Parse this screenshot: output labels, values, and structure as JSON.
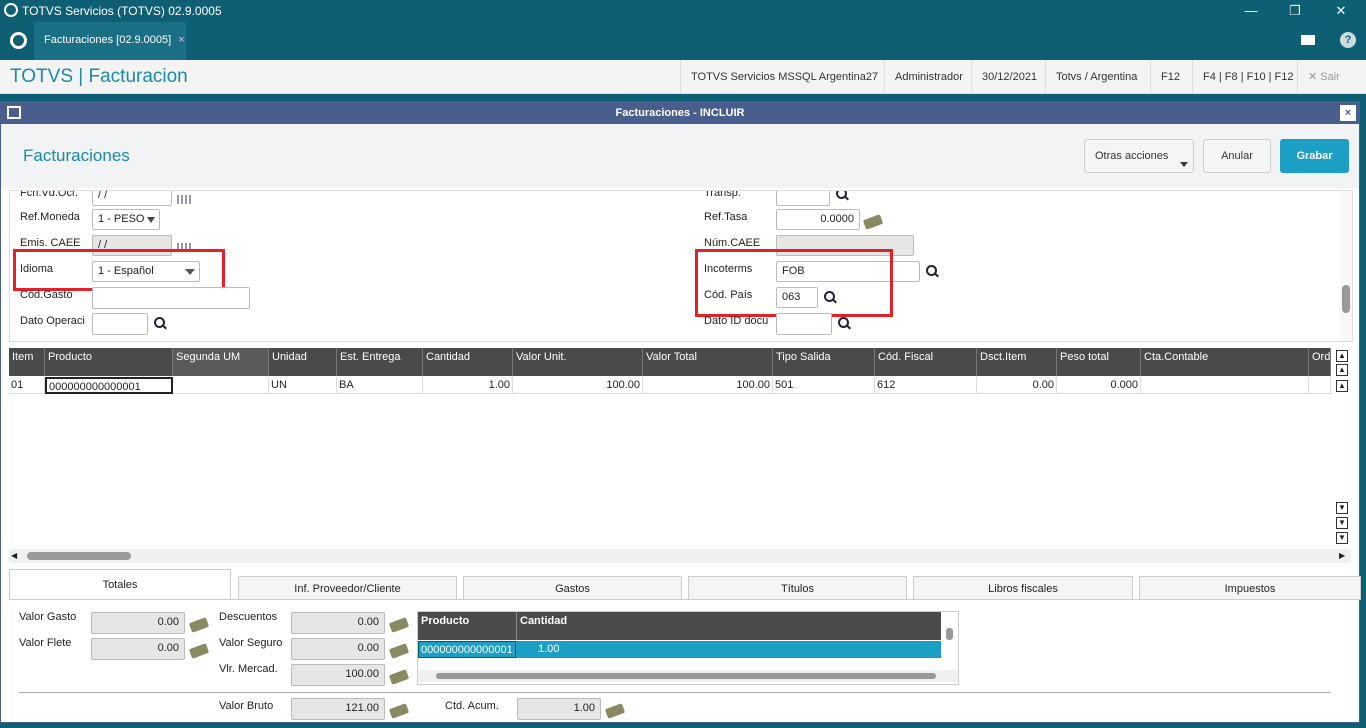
{
  "window": {
    "title": "TOTVS Servicios (TOTVS) 02.9.0005",
    "minimize": "—",
    "maximize": "❐",
    "close": "✕"
  },
  "tabbar": {
    "tab_label": "Facturaciones [02.9.0005]",
    "tab_close": "×"
  },
  "header": {
    "app_title": "TOTVS | Facturacion",
    "items": [
      "TOTVS Servicios MSSQL Argentina27",
      "Administrador",
      "30/12/2021",
      "Totvs / Argentina",
      "F12",
      "F4 | F8 | F10 | F12"
    ],
    "exit_label": "Sair"
  },
  "dialog": {
    "title": "Facturaciones - INCLUIR",
    "heading": "Facturaciones",
    "buttons": {
      "other_actions": "Otras acciones",
      "cancel": "Anular",
      "save": "Grabar"
    }
  },
  "form": {
    "left": {
      "fec_label": "Fch.Vd.Ocr.",
      "fec_value": "/ /",
      "moneda_label": "Ref.Moneda",
      "moneda_value": "1 - PESO",
      "caee_label": "Emis. CAEE",
      "caee_value": "/ /",
      "idioma_label": "Idioma",
      "idioma_value": "1 - Español",
      "gasto_label": "Cód.Gasto",
      "operaci_label": "Dato Operaci"
    },
    "right": {
      "transp_label": "Transp.",
      "tasa_label": "Ref.Tasa",
      "tasa_value": "0.0000",
      "num_caee_label": "Núm.CAEE",
      "incoterms_label": "Incoterms",
      "incoterms_value": "FOB",
      "pais_label": "Cód. País",
      "pais_value": "063",
      "dato_id_label": "Dato ID docu"
    }
  },
  "grid": {
    "columns": [
      "Item",
      "Producto",
      "Segunda UM",
      "Unidad",
      "Est. Entrega",
      "Cantidad",
      "Valor Unit.",
      "Valor Total",
      "Tipo Salida",
      "Cód. Fiscal",
      "Dsct.Item",
      "Peso total",
      "Cta.Contable",
      "Ord."
    ],
    "rows": [
      [
        "01",
        "000000000000001",
        "",
        "UN",
        "BA",
        "1.00",
        "100.00",
        "100.00",
        "501",
        "612",
        "0.00",
        "0.000",
        "",
        ""
      ]
    ]
  },
  "tabs": [
    "Totales",
    "Inf. Proveedor/Cliente",
    "Gastos",
    "Títulos",
    "Libros fiscales",
    "Impuestos"
  ],
  "totales": {
    "valor_gasto_label": "Valor Gasto",
    "valor_gasto": "0.00",
    "valor_flete_label": "Valor Flete",
    "valor_flete": "0.00",
    "descuentos_label": "Descuentos",
    "descuentos": "0.00",
    "valor_seguro_label": "Valor Seguro",
    "valor_seguro": "0.00",
    "vlr_mercad_label": "Vlr. Mercad.",
    "vlr_mercad": "100.00",
    "valor_bruto_label": "Valor Bruto",
    "valor_bruto": "121.00",
    "ctd_acum_label": "Ctd. Acum.",
    "ctd_acum": "1.00",
    "mini_grid": {
      "headers": [
        "Producto",
        "Cantidad"
      ],
      "row": [
        "000000000000001",
        "1.00"
      ]
    }
  }
}
